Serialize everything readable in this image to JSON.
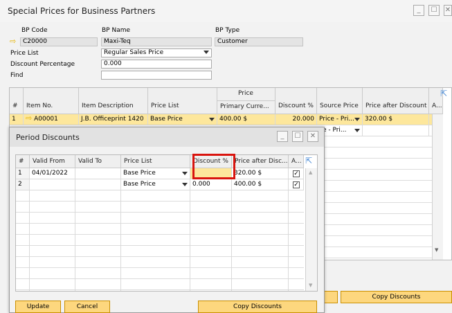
{
  "window": {
    "title": "Special Prices for Business Partners"
  },
  "header": {
    "bp_code_label": "BP Code",
    "bp_name_label": "BP Name",
    "bp_type_label": "BP Type",
    "bp_code": "C20000",
    "bp_name": "Maxi-Teq",
    "bp_type": "Customer",
    "price_list_label": "Price List",
    "price_list": "Regular Sales Price",
    "discount_pct_label": "Discount Percentage",
    "discount_pct": "0.000",
    "find_label": "Find",
    "find_value": ""
  },
  "main_grid": {
    "group_header": "Price",
    "columns": [
      "#",
      "Item No.",
      "Item Description",
      "Price List",
      "Primary Curre...",
      "Discount %",
      "Source Price",
      "Price after Discount",
      "A..."
    ],
    "rows": [
      {
        "num": "1",
        "item_no": "A00001",
        "desc": "J.B. Officeprint 1420",
        "price_list": "Base Price",
        "primary": "400.00 $",
        "discount": "20.000",
        "source": "Price - Pri...",
        "after": "320.00 $"
      },
      {
        "num": "",
        "item_no": "",
        "desc": "",
        "price_list": "",
        "primary": "",
        "discount": "",
        "source": "ce - Pri...",
        "after": ""
      }
    ]
  },
  "main_footer": {
    "copy_discounts": "Copy Discounts"
  },
  "popup": {
    "title": "Period Discounts",
    "columns": [
      "#",
      "Valid From",
      "Valid To",
      "Price List",
      "Discount %",
      "Price after Disc...",
      "A..."
    ],
    "rows": [
      {
        "num": "1",
        "valid_from": "04/01/2022",
        "valid_to": "",
        "price_list": "Base Price",
        "discount": "",
        "after": "320.00 $"
      },
      {
        "num": "2",
        "valid_from": "",
        "valid_to": "",
        "price_list": "Base Price",
        "discount": "0.000",
        "after": "400.00 $"
      }
    ],
    "buttons": {
      "update": "Update",
      "cancel": "Cancel",
      "copy_discounts": "Copy Discounts"
    }
  },
  "colors": {
    "accent": "#fdd77e",
    "highlight_row": "#fde79c",
    "annotation_box": "#d9140e"
  }
}
